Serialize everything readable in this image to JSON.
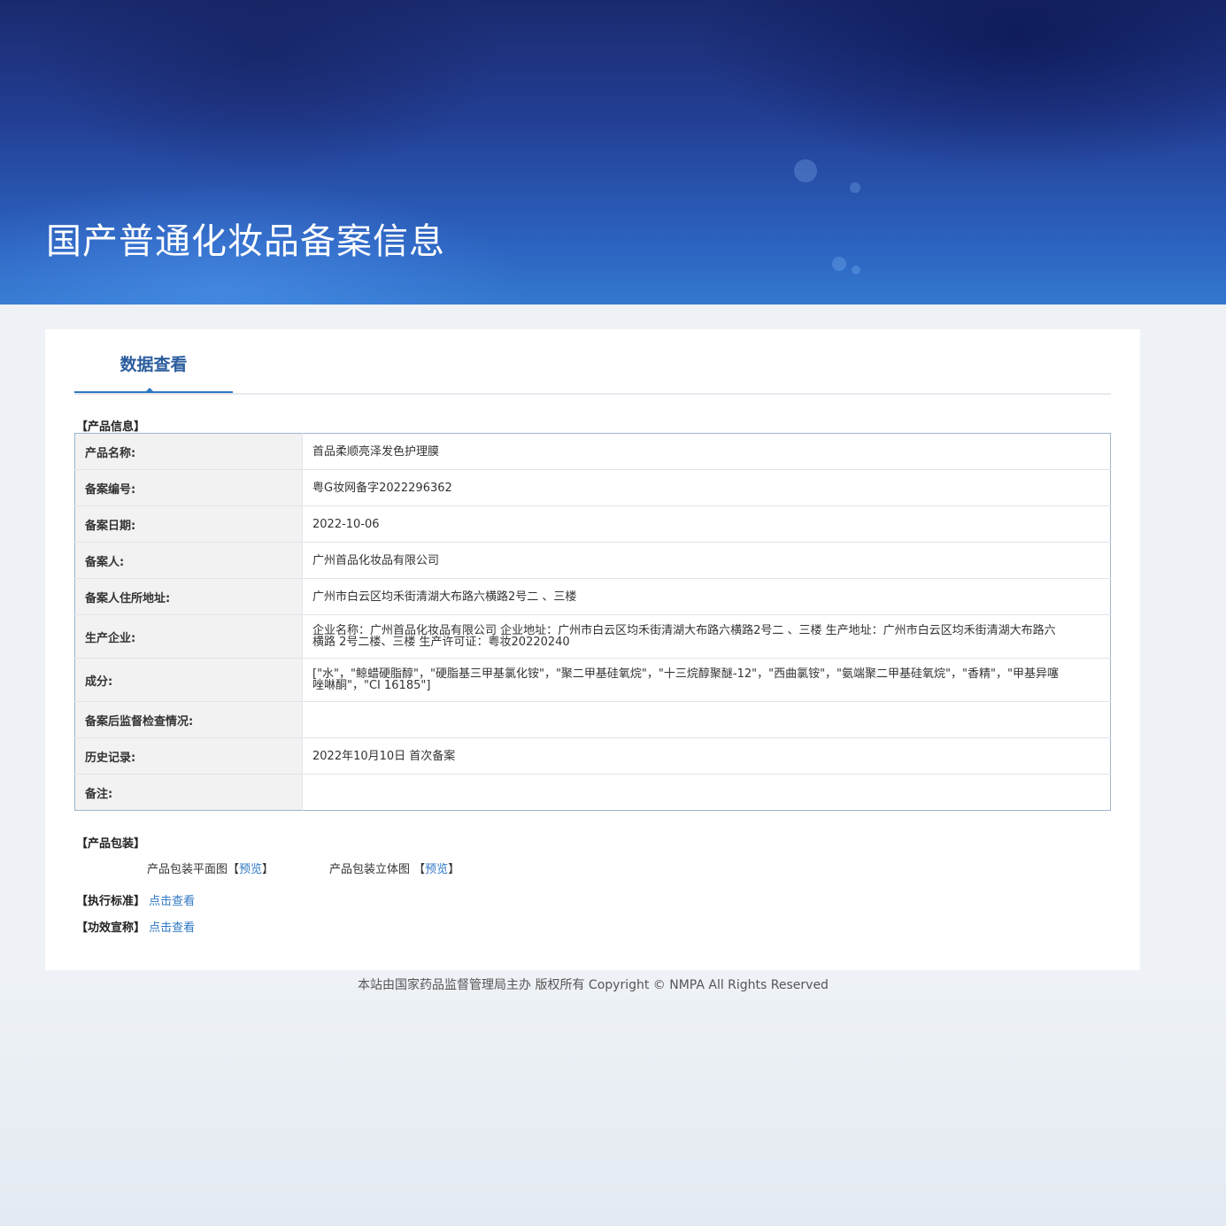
{
  "banner": {
    "title": "国产普通化妆品备案信息"
  },
  "tabs": [
    {
      "label": "数据查看"
    }
  ],
  "product_info": {
    "section_title": "【产品信息】",
    "rows": [
      {
        "label": "产品名称:",
        "value": "首品柔顺亮泽发色护理膜"
      },
      {
        "label": "备案编号:",
        "value": "粤G妆网备字2022296362"
      },
      {
        "label": "备案日期:",
        "value": "2022-10-06"
      },
      {
        "label": "备案人:",
        "value": "广州首品化妆品有限公司"
      },
      {
        "label": "备案人住所地址:",
        "value": "广州市白云区均禾街清湖大布路六横路2号二 、三楼"
      },
      {
        "label": "生产企业:",
        "value": "企业名称：广州首品化妆品有限公司 企业地址：广州市白云区均禾街清湖大布路六横路2号二 、三楼 生产地址：广州市白云区均禾街清湖大布路六横路 2号二楼、三楼 生产许可证：粤妆20220240"
      },
      {
        "label": "成分:",
        "value": "[\"水\"，\"鲸蜡硬脂醇\"，\"硬脂基三甲基氯化铵\"，\"聚二甲基硅氧烷\"，\"十三烷醇聚醚-12\"，\"西曲氯铵\"，\"氨端聚二甲基硅氧烷\"，\"香精\"，\"甲基异噻唑啉酮\"，\"CI 16185\"]"
      },
      {
        "label": "备案后监督检查情况:",
        "value": ""
      },
      {
        "label": "历史记录:",
        "value": "2022年10月10日 首次备案"
      },
      {
        "label": "备注:",
        "value": ""
      }
    ]
  },
  "packaging": {
    "section_title": "【产品包装】",
    "flat_label": "产品包装平面图",
    "solid_label": "产品包装立体图",
    "bracket_open": "【",
    "bracket_close": "】",
    "preview_link": "预览"
  },
  "standard": {
    "section_title": "【执行标准】",
    "link": "点击查看"
  },
  "efficacy": {
    "section_title": "【功效宣称】",
    "link": "点击查看"
  },
  "footer": {
    "text": "本站由国家药品监督管理局主办 版权所有 Copyright © NMPA All Rights Reserved"
  },
  "colors": {
    "accent": "#2f78c5",
    "link": "#2f78c5",
    "banner_dark": "#1a2a6e",
    "banner_light": "#3378cf"
  }
}
